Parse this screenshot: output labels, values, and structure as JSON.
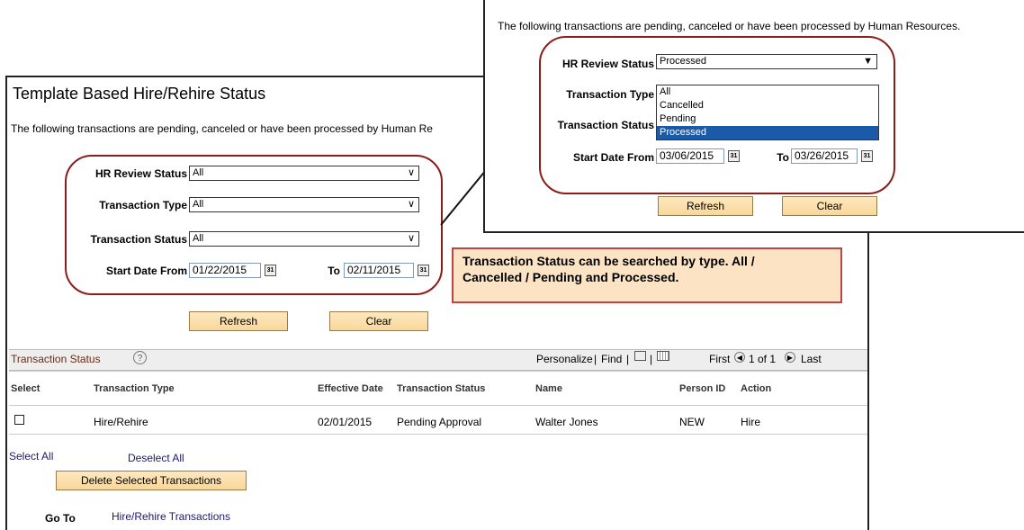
{
  "main": {
    "title": "Template Based Hire/Rehire Status",
    "intro": "The following transactions are pending, canceled or have been processed by Human Re",
    "filters": {
      "hr_review_label": "HR Review Status",
      "hr_review_value": "All",
      "txn_type_label": "Transaction Type",
      "txn_type_value": "All",
      "txn_status_label": "Transaction Status",
      "txn_status_value": "All",
      "start_label": "Start Date From",
      "start_value": "01/22/2015",
      "to_label": "To",
      "to_value": "02/11/2015"
    },
    "refresh_label": "Refresh",
    "clear_label": "Clear",
    "grid": {
      "title": "Transaction Status",
      "help": "?",
      "personalize": "Personalize",
      "find": "Find",
      "first": "First",
      "range": "1 of 1",
      "last": "Last",
      "columns": [
        "Select",
        "Transaction Type",
        "Effective Date",
        "Transaction Status",
        "Name",
        "Person ID",
        "Action"
      ],
      "rows": [
        {
          "type": "Hire/Rehire",
          "effective": "02/01/2015",
          "status": "Pending Approval",
          "name": "Walter Jones",
          "person_id": "NEW",
          "action": "Hire"
        }
      ]
    },
    "select_all": "Select All",
    "deselect_all": "Deselect All",
    "delete_label": "Delete Selected Transactions",
    "goto_label": "Go To",
    "goto_link": "Hire/Rehire Transactions"
  },
  "callout": {
    "line1": "Transaction Status can be searched by type.  All /",
    "line2": "Cancelled / Pending and Processed."
  },
  "popup": {
    "intro": "The following transactions are pending, canceled or have been processed by Human Resources.",
    "hr_review_label": "HR Review Status",
    "hr_review_value": "Processed",
    "txn_type_label": "Transaction Type",
    "txn_status_label": "Transaction Status",
    "options": [
      "All",
      "Cancelled",
      "Pending",
      "Processed"
    ],
    "start_label": "Start Date From",
    "start_value": "03/06/2015",
    "to_label": "To",
    "to_value": "03/26/2015",
    "refresh_label": "Refresh",
    "clear_label": "Clear"
  },
  "icons": {
    "calendar": "calendar-icon",
    "dropdown": "chevron-down-icon"
  },
  "colors": {
    "oval": "#8b1c1c",
    "callout_bg": "#fbe3c4",
    "highlight": "#1a5aa8"
  }
}
